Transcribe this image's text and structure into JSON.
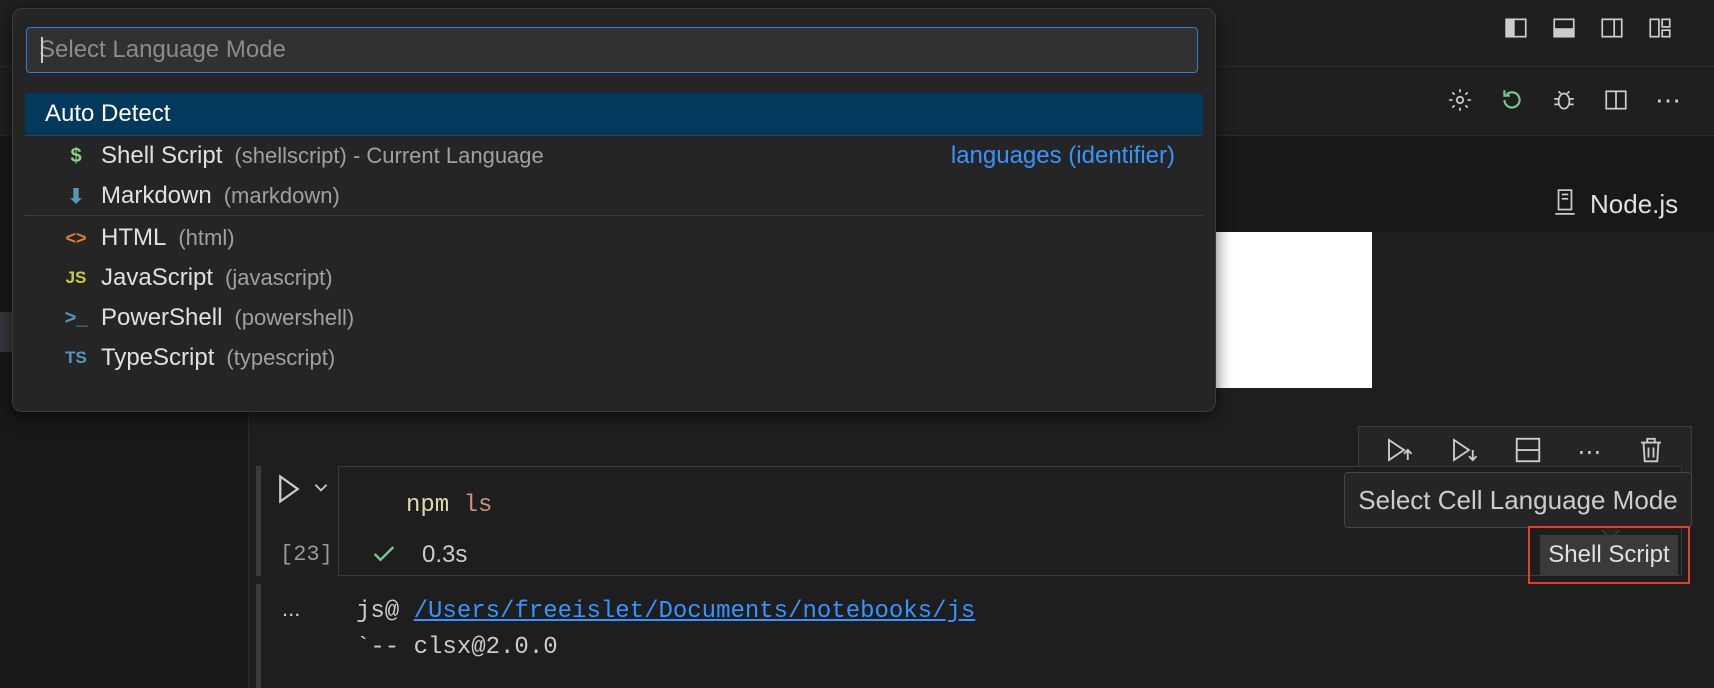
{
  "quick_pick": {
    "placeholder": "Select Language Mode",
    "items": [
      {
        "icon": "auto",
        "name": "Auto Detect",
        "desc": "",
        "detail": "",
        "selected": true
      },
      {
        "icon": "$",
        "name": "Shell Script",
        "desc": "(shellscript) - Current Language",
        "detail": "languages (identifier)"
      },
      {
        "icon": "⬇",
        "name": "Markdown",
        "desc": "(markdown)",
        "detail": ""
      },
      {
        "icon": "<>",
        "name": "HTML",
        "desc": "(html)",
        "detail": ""
      },
      {
        "icon": "JS",
        "name": "JavaScript",
        "desc": "(javascript)",
        "detail": ""
      },
      {
        "icon": ">_",
        "name": "PowerShell",
        "desc": "(powershell)",
        "detail": ""
      },
      {
        "icon": "TS",
        "name": "TypeScript",
        "desc": "(typescript)",
        "detail": ""
      }
    ]
  },
  "kernel": {
    "label": "Node.js"
  },
  "cell": {
    "exec_count": "[23]",
    "code_cmd": "npm",
    "code_arg": "ls",
    "duration": "0.3s",
    "output_prefix": "js@",
    "output_path": "/Users/freeislet/Documents/notebooks/js",
    "output_line2": "`-- clsx@2.0.0",
    "more": "...",
    "language": "Shell Script"
  },
  "tooltip": {
    "text": "Select Cell Language Mode"
  },
  "colors": {
    "accent": "#3794ff",
    "selected_bg": "#04395e",
    "highlight_border": "#e0402a",
    "success": "#73c991",
    "restart_green": "#73c991"
  }
}
